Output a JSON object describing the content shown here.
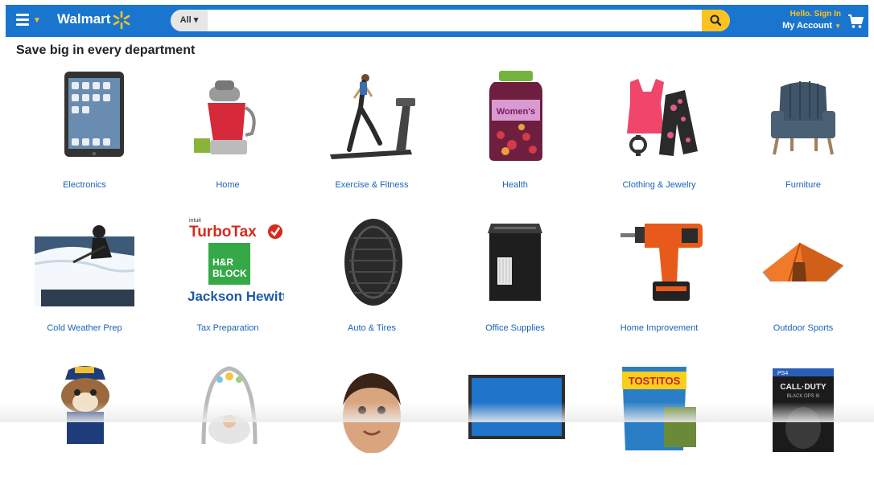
{
  "header": {
    "logo": "Walmart",
    "search": {
      "department": "All",
      "placeholder": ""
    },
    "account": {
      "greeting": "Hello. Sign In",
      "label": "My Account"
    }
  },
  "section": {
    "title": "Save big in every department"
  },
  "departments": [
    {
      "label": "Electronics"
    },
    {
      "label": "Home"
    },
    {
      "label": "Exercise & Fitness"
    },
    {
      "label": "Health"
    },
    {
      "label": "Clothing & Jewelry"
    },
    {
      "label": "Furniture"
    },
    {
      "label": "Cold Weather Prep"
    },
    {
      "label": "Tax Preparation"
    },
    {
      "label": "Auto & Tires"
    },
    {
      "label": "Office Supplies"
    },
    {
      "label": "Home Improvement"
    },
    {
      "label": "Outdoor Sports"
    }
  ],
  "tax_prep_image": {
    "brand1": "TurboTax",
    "brand1_prefix": "intuit",
    "brand2_line1": "H&R",
    "brand2_line2": "BLOCK",
    "brand3": "Jackson Hewitt"
  },
  "product_text": {
    "vitamin": "Women's",
    "chips": "TOSTITOS",
    "game": "CALL·DUTY",
    "game_sub": "BLACK OPS III",
    "platform": "PS4"
  },
  "colors": {
    "header_bg": "#1a75cf",
    "accent_yellow": "#fcc220",
    "link_blue": "#1a63b8"
  }
}
